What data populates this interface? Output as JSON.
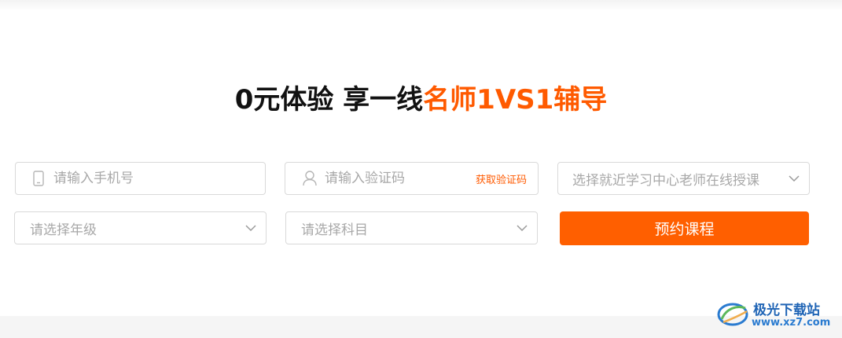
{
  "headline": {
    "part_black": "0元体验 享一线",
    "part_accent": "名师1VS1辅导"
  },
  "form": {
    "phone": {
      "placeholder": "请输入手机号",
      "icon": "phone-icon"
    },
    "code": {
      "placeholder": "请输入验证码",
      "icon": "user-icon",
      "get_code_label": "获取验证码"
    },
    "center": {
      "placeholder": "选择就近学习中心老师在线授课"
    },
    "grade": {
      "placeholder": "请选择年级"
    },
    "subject": {
      "placeholder": "请选择科目"
    },
    "submit_label": "预约课程"
  },
  "watermark": {
    "text": "极光下载站",
    "url": "www.xz7.com"
  },
  "colors": {
    "accent": "#ff5a00",
    "button": "#ff5f00",
    "border": "#d9d9d9",
    "placeholder": "#a8a8a8"
  }
}
